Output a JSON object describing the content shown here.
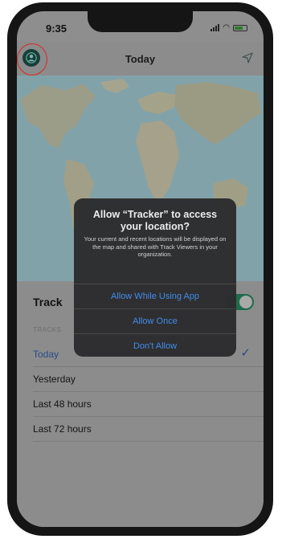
{
  "status_bar": {
    "time": "9:35"
  },
  "nav": {
    "title": "Today",
    "profile_icon": "person-icon",
    "action_icon": "location-arrow-icon"
  },
  "colors": {
    "accent": "#3f8cf0",
    "toggle_on": "#1e6b4c",
    "highlight": "#d42a2a"
  },
  "track_toggle": {
    "label": "Track",
    "on": true
  },
  "section_header": "TRACKS",
  "list": [
    {
      "label": "Today",
      "selected": true
    },
    {
      "label": "Yesterday",
      "selected": false
    },
    {
      "label": "Last 48 hours",
      "selected": false
    },
    {
      "label": "Last 72 hours",
      "selected": false
    }
  ],
  "alert": {
    "title": "Allow “Tracker” to access your location?",
    "message": "Your current and recent locations will be displayed on the map and shared with Track Viewers in your organization.",
    "buttons": [
      "Allow While Using App",
      "Allow Once",
      "Don't Allow"
    ]
  }
}
